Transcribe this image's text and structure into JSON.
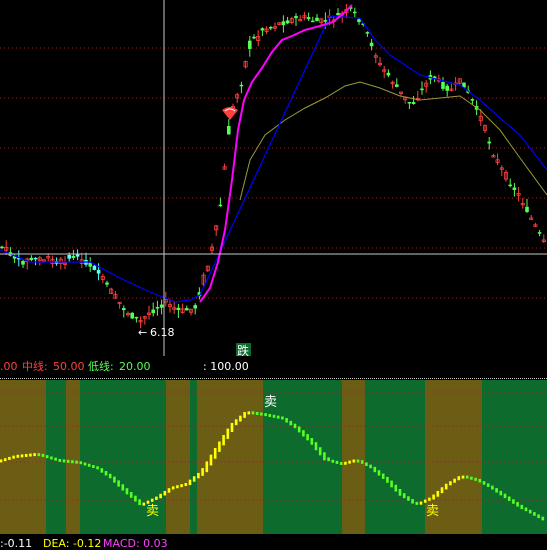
{
  "main_chart": {
    "low_marker": "6.18",
    "signal_label": "跌",
    "colors": {
      "up_candle": "#ff4040",
      "down_candle": "#54ff54",
      "flat_candle": "#54ffff",
      "ma_short": "#ff00ff",
      "ma_mid": "#0000ff",
      "ma_long": "#9a9a3a",
      "crosshair": "#c8c8c8",
      "grid": "#9b1c1c",
      "warning": "#ff4040"
    }
  },
  "info_bar": {
    "prefix": ".00",
    "mid_label": "中线:",
    "mid_value": "50.00",
    "low_label": "低线:",
    "low_value": "20.00",
    "top_value": ": 100.00",
    "colors": {
      "prefix": "#ff4040",
      "mid": "#ff4040",
      "low": "#54ff54",
      "top": "#ffffff"
    }
  },
  "sub_chart": {
    "signals": [
      {
        "text": "卖"
      },
      {
        "text": "卖"
      },
      {
        "text": "卖"
      }
    ],
    "colors": {
      "dark_green": "#0d6b2e",
      "olive": "#6b5e14",
      "line_yellow": "#ffff00",
      "line_green": "#54ff24"
    }
  },
  "macd_bar": {
    "prefix": ":-0.11",
    "dea": "DEA: -0.12",
    "macd": "MACD: 0.03",
    "colors": {
      "prefix": "#ffffff",
      "dea": "#ffff00",
      "macd": "#ff40ff"
    }
  }
}
